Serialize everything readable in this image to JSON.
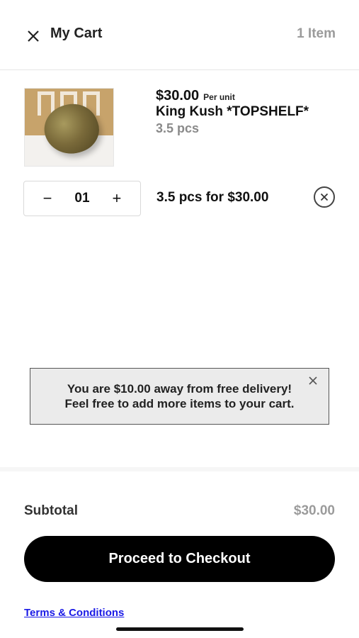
{
  "header": {
    "title": "My Cart",
    "item_count": "1 Item"
  },
  "cart_item": {
    "price": "$30.00",
    "per_unit_label": "Per unit",
    "name": "King Kush *TOPSHELF*",
    "size": "3.5 pcs",
    "quantity": "01",
    "line_summary": "3.5 pcs for $30.00",
    "decrement_symbol": "−",
    "increment_symbol": "+"
  },
  "promo": {
    "line1": "You are $10.00 away from free delivery!",
    "line2": "Feel free to add more items to your cart."
  },
  "summary": {
    "subtotal_label": "Subtotal",
    "subtotal_value": "$30.00"
  },
  "checkout_button": "Proceed to Checkout",
  "terms_link": "Terms & Conditions",
  "icons": {
    "close": "close-icon",
    "remove": "remove-circle-icon",
    "promo_close": "close-icon"
  },
  "colors": {
    "accent": "#000000",
    "muted_text": "#9b9b9b",
    "link": "#1a1ae6",
    "promo_bg": "#ebebeb"
  }
}
